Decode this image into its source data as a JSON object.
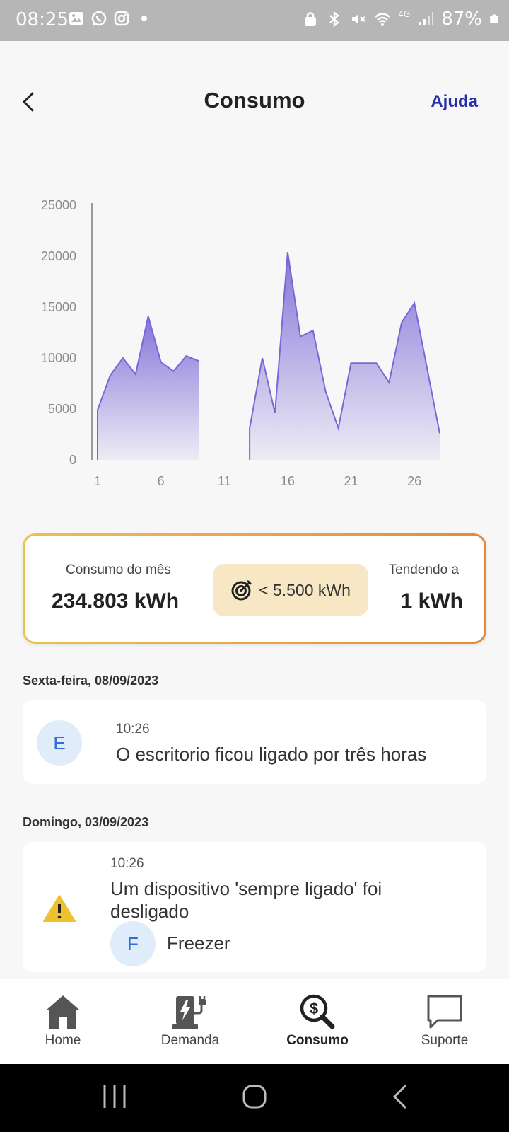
{
  "status_bar": {
    "time": "08:25",
    "network": "4G",
    "battery": "87%",
    "left_icons": [
      "gallery-icon",
      "whatsapp-icon",
      "instagram-icon",
      "dot-icon"
    ],
    "right_icons": [
      "lock-icon",
      "bluetooth-icon",
      "mute-icon",
      "wifi-icon",
      "signal-icon",
      "battery-icon"
    ]
  },
  "header": {
    "title": "Consumo",
    "help_label": "Ajuda"
  },
  "chart_data": {
    "type": "area",
    "color": "#7a66d6",
    "x_ticks": [
      1,
      6,
      11,
      16,
      21,
      26
    ],
    "y_ticks": [
      0,
      5000,
      10000,
      15000,
      20000,
      25000
    ],
    "xlim": [
      1,
      28
    ],
    "ylim": [
      0,
      25000
    ],
    "grid": false,
    "segments": [
      {
        "x": [
          1,
          2,
          3,
          4,
          5,
          6,
          7,
          8,
          9
        ],
        "y": [
          4900,
          8300,
          10000,
          8400,
          14100,
          9600,
          8700,
          10200,
          9700
        ]
      },
      {
        "x": [
          13,
          14,
          15,
          16,
          17,
          18,
          19,
          20,
          21,
          22,
          23,
          24,
          25,
          26,
          27,
          28
        ],
        "y": [
          3100,
          10000,
          4600,
          20400,
          12100,
          12700,
          6700,
          3100,
          9500,
          9500,
          9500,
          7600,
          13500,
          15400,
          9000,
          2600
        ]
      }
    ]
  },
  "summary": {
    "month_label": "Consumo do mês",
    "month_value": "234.803 kWh",
    "goal_text": "<  5.500 kWh",
    "trend_label": "Tendendo a",
    "trend_value": "1 kWh"
  },
  "events": [
    {
      "date": "Sexta-feira, 08/09/2023",
      "time": "10:26",
      "avatar": "E",
      "text": "O escritorio ficou ligado por três horas"
    },
    {
      "date": "Domingo, 03/09/2023",
      "time": "10:26",
      "text_line1": "Um dispositivo 'sempre ligado' foi",
      "text_line2": "desligado",
      "device_avatar": "F",
      "device_name": "Freezer"
    }
  ],
  "bottom_nav": [
    {
      "label": "Home",
      "icon": "home-icon"
    },
    {
      "label": "Demanda",
      "icon": "ev-charger-icon"
    },
    {
      "label": "Consumo",
      "icon": "money-search-icon",
      "active": true
    },
    {
      "label": "Suporte",
      "icon": "chat-bubble-icon"
    }
  ]
}
